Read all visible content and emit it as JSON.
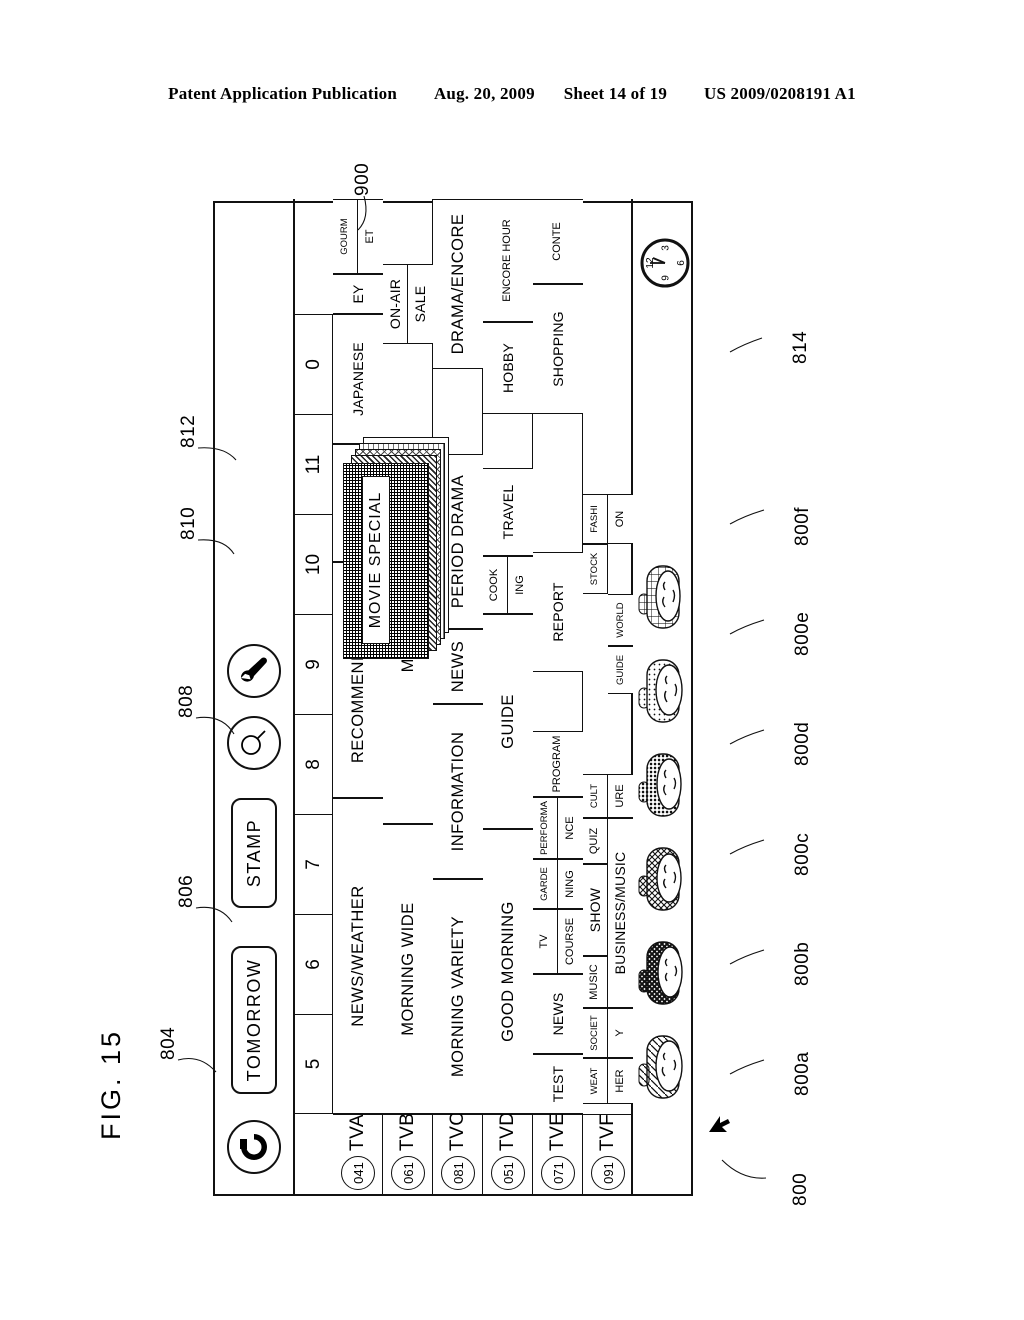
{
  "header": {
    "publication": "Patent Application Publication",
    "date": "Aug. 20, 2009",
    "sheet": "Sheet 14 of 19",
    "docnum": "US 2009/0208191 A1"
  },
  "figure": {
    "label": "FIG. 15"
  },
  "toolbar": {
    "refresh_icon": "refresh-icon",
    "tomorrow_label": "TOMORROW",
    "stamp_label": "STAMP",
    "search_icon": "magnifier-icon",
    "settings_icon": "wrench-icon"
  },
  "ruler": {
    "hours": [
      "5",
      "6",
      "7",
      "8",
      "9",
      "10",
      "11",
      "0"
    ]
  },
  "channels": [
    {
      "number": "041",
      "name": "TVA"
    },
    {
      "number": "061",
      "name": "TVB"
    },
    {
      "number": "081",
      "name": "TVC"
    },
    {
      "number": "051",
      "name": "TVD"
    },
    {
      "number": "071",
      "name": "TVE"
    },
    {
      "number": "091",
      "name": "TVF"
    }
  ],
  "programs": {
    "TVA": [
      {
        "title": "NEWS/WEATHER"
      },
      {
        "title": "RECOMMENDATION"
      },
      {
        "title": "GOURMET"
      },
      {
        "title": "JAPANESE"
      },
      {
        "title": "EY"
      },
      {
        "title": "GOURM"
      },
      {
        "title": "ET"
      }
    ],
    "TVB": [
      {
        "title": "MORNING WIDE"
      },
      {
        "title": "MARKET"
      },
      {
        "title": "ON-AIR"
      },
      {
        "title": "SALE"
      }
    ],
    "TVC": [
      {
        "title": "MORNING VARIETY"
      },
      {
        "title": "INFORMATION"
      },
      {
        "title": "NEWS"
      },
      {
        "title": "PERIOD DRAMA"
      },
      {
        "title": "DRAMA/ENCORE"
      }
    ],
    "TVD": [
      {
        "title": "GOOD MORNING"
      },
      {
        "title": "GUIDE"
      },
      {
        "title": "COOK"
      },
      {
        "title": "ING"
      },
      {
        "title": "TRAVEL"
      },
      {
        "title": "HOBBY"
      },
      {
        "title": "ENCORE HOUR"
      }
    ],
    "TVE": [
      {
        "title": "TEST"
      },
      {
        "title": "NEWS"
      },
      {
        "title": "TV"
      },
      {
        "title": "COURSE"
      },
      {
        "title": "GARDE"
      },
      {
        "title": "NING"
      },
      {
        "title": "PERFORMA"
      },
      {
        "title": "NCE"
      },
      {
        "title": "PROGRAM"
      },
      {
        "title": "REPORT"
      },
      {
        "title": "SHOPPING"
      },
      {
        "title": "CONTE"
      }
    ],
    "TVF": [
      {
        "title": "WEAT"
      },
      {
        "title": "HER"
      },
      {
        "title": "SOCIET"
      },
      {
        "title": "Y"
      },
      {
        "title": "MUSIC"
      },
      {
        "title": "SHOW"
      },
      {
        "title": "BUSINESS/MUSIC"
      },
      {
        "title": "QUIZ"
      },
      {
        "title": "CULT"
      },
      {
        "title": "URE"
      },
      {
        "title": "GUIDE"
      },
      {
        "title": "WORLD"
      },
      {
        "title": "STOCK"
      },
      {
        "title": "FASHI"
      },
      {
        "title": "ON"
      }
    ]
  },
  "popup": {
    "title": "MOVIE SPECIAL"
  },
  "clock": {
    "marks": [
      "12",
      "3",
      "6",
      "9"
    ]
  },
  "refs": {
    "r800": "800",
    "r800a": "800a",
    "r800b": "800b",
    "r800c": "800c",
    "r800d": "800d",
    "r800e": "800e",
    "r800f": "800f",
    "r804": "804",
    "r806": "806",
    "r808": "808",
    "r810": "810",
    "r812": "812",
    "r814": "814",
    "r900": "900"
  }
}
